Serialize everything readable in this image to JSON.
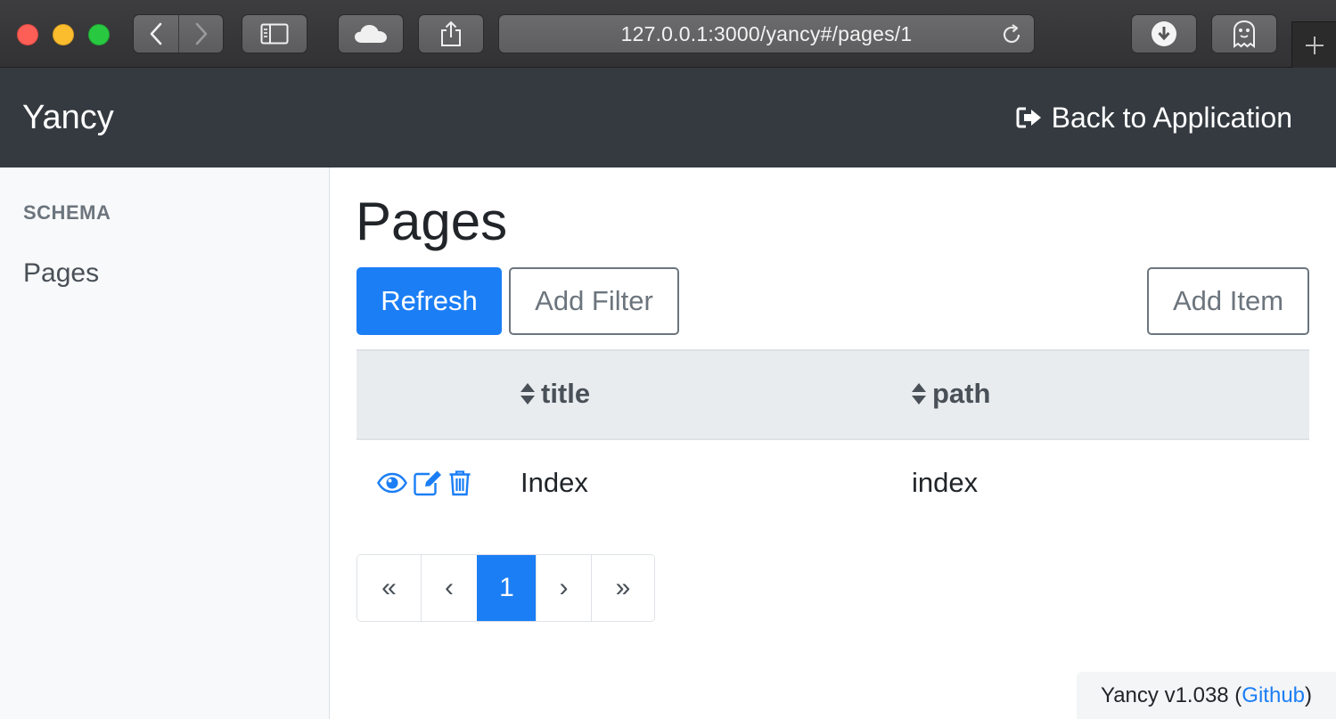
{
  "browser": {
    "url": "127.0.0.1:3000/yancy#/pages/1"
  },
  "navbar": {
    "brand": "Yancy",
    "back_link": "Back to Application"
  },
  "sidebar": {
    "heading": "SCHEMA",
    "items": [
      {
        "label": "Pages"
      }
    ]
  },
  "main": {
    "title": "Pages",
    "buttons": {
      "refresh": "Refresh",
      "add_filter": "Add Filter",
      "add_item": "Add Item"
    },
    "table": {
      "columns": [
        "title",
        "path"
      ],
      "rows": [
        {
          "title": "Index",
          "path": "index"
        }
      ]
    },
    "pagination": {
      "first": "«",
      "prev": "‹",
      "current": "1",
      "next": "›",
      "last": "»"
    }
  },
  "footer": {
    "version_text": "Yancy v1.038 (",
    "link": "Github",
    "close": ")"
  },
  "colors": {
    "primary": "#1b7ef5",
    "navbar": "#343a40",
    "sidebar": "#f8f9fa"
  }
}
